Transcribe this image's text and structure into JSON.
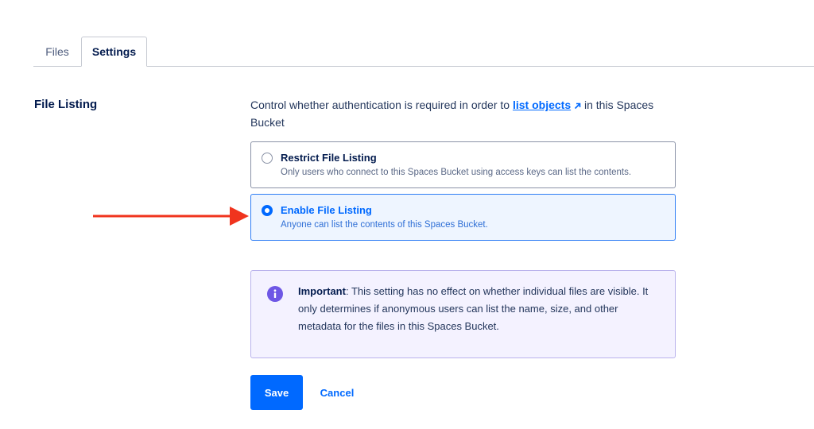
{
  "tabs": [
    {
      "label": "Files",
      "active": false
    },
    {
      "label": "Settings",
      "active": true
    }
  ],
  "section": {
    "label": "File Listing",
    "description_before": "Control whether authentication is required in order to ",
    "link_text": "list objects",
    "description_after": " in this Spaces Bucket"
  },
  "options": [
    {
      "title": "Restrict File Listing",
      "subtitle": "Only users who connect to this Spaces Bucket using access keys can list the contents.",
      "selected": false
    },
    {
      "title": "Enable File Listing",
      "subtitle": "Anyone can list the contents of this Spaces Bucket.",
      "selected": true
    }
  ],
  "info": {
    "strong": "Important",
    "text": ": This setting has no effect on whether individual files are visible. It only determines if anonymous users can list the name, size, and other metadata for the files in this Spaces Bucket."
  },
  "buttons": {
    "save": "Save",
    "cancel": "Cancel"
  },
  "colors": {
    "accent": "#0069ff",
    "annotation_arrow": "#f0341e",
    "info_icon": "#6e57e5"
  },
  "icons": {
    "external_link": "external-link-icon",
    "info": "info-icon",
    "annotation": "red-arrow-icon"
  }
}
